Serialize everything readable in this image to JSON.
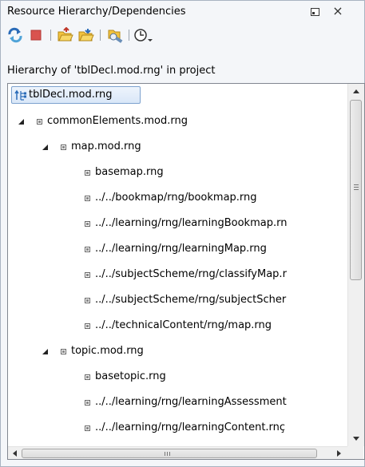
{
  "panel": {
    "title": "Resource Hierarchy/Dependencies",
    "close_glyph": "×"
  },
  "toolbar": {
    "buttons": [
      {
        "icon": "refresh-icon"
      },
      {
        "icon": "stop-icon"
      },
      {
        "icon": "folder-hierarchy-icon"
      },
      {
        "icon": "folder-dependencies-icon"
      },
      {
        "icon": "configure-scope-icon"
      },
      {
        "icon": "history-dropdown-icon"
      }
    ]
  },
  "caption": "Hierarchy of 'tblDecl.mod.rng' in project",
  "tree": {
    "root": "tblDecl.mod.rng",
    "nodes": [
      {
        "label": "commonElements.mod.rng",
        "expanded": true
      },
      {
        "label": "map.mod.rng",
        "expanded": true
      },
      {
        "label": "basemap.rng"
      },
      {
        "label": "../../bookmap/rng/bookmap.rng"
      },
      {
        "label": "../../learning/rng/learningBookmap.rn"
      },
      {
        "label": "../../learning/rng/learningMap.rng"
      },
      {
        "label": "../../subjectScheme/rng/classifyMap.r"
      },
      {
        "label": "../../subjectScheme/rng/subjectScher"
      },
      {
        "label": "../../technicalContent/rng/map.rng"
      },
      {
        "label": "topic.mod.rng",
        "expanded": true
      },
      {
        "label": "basetopic.rng"
      },
      {
        "label": "../../learning/rng/learningAssessment"
      },
      {
        "label": "../../learning/rng/learningContent.rnç"
      }
    ]
  },
  "colors": {
    "panel_bg": "#f4f6f9",
    "selection_border": "#7da2ce"
  }
}
